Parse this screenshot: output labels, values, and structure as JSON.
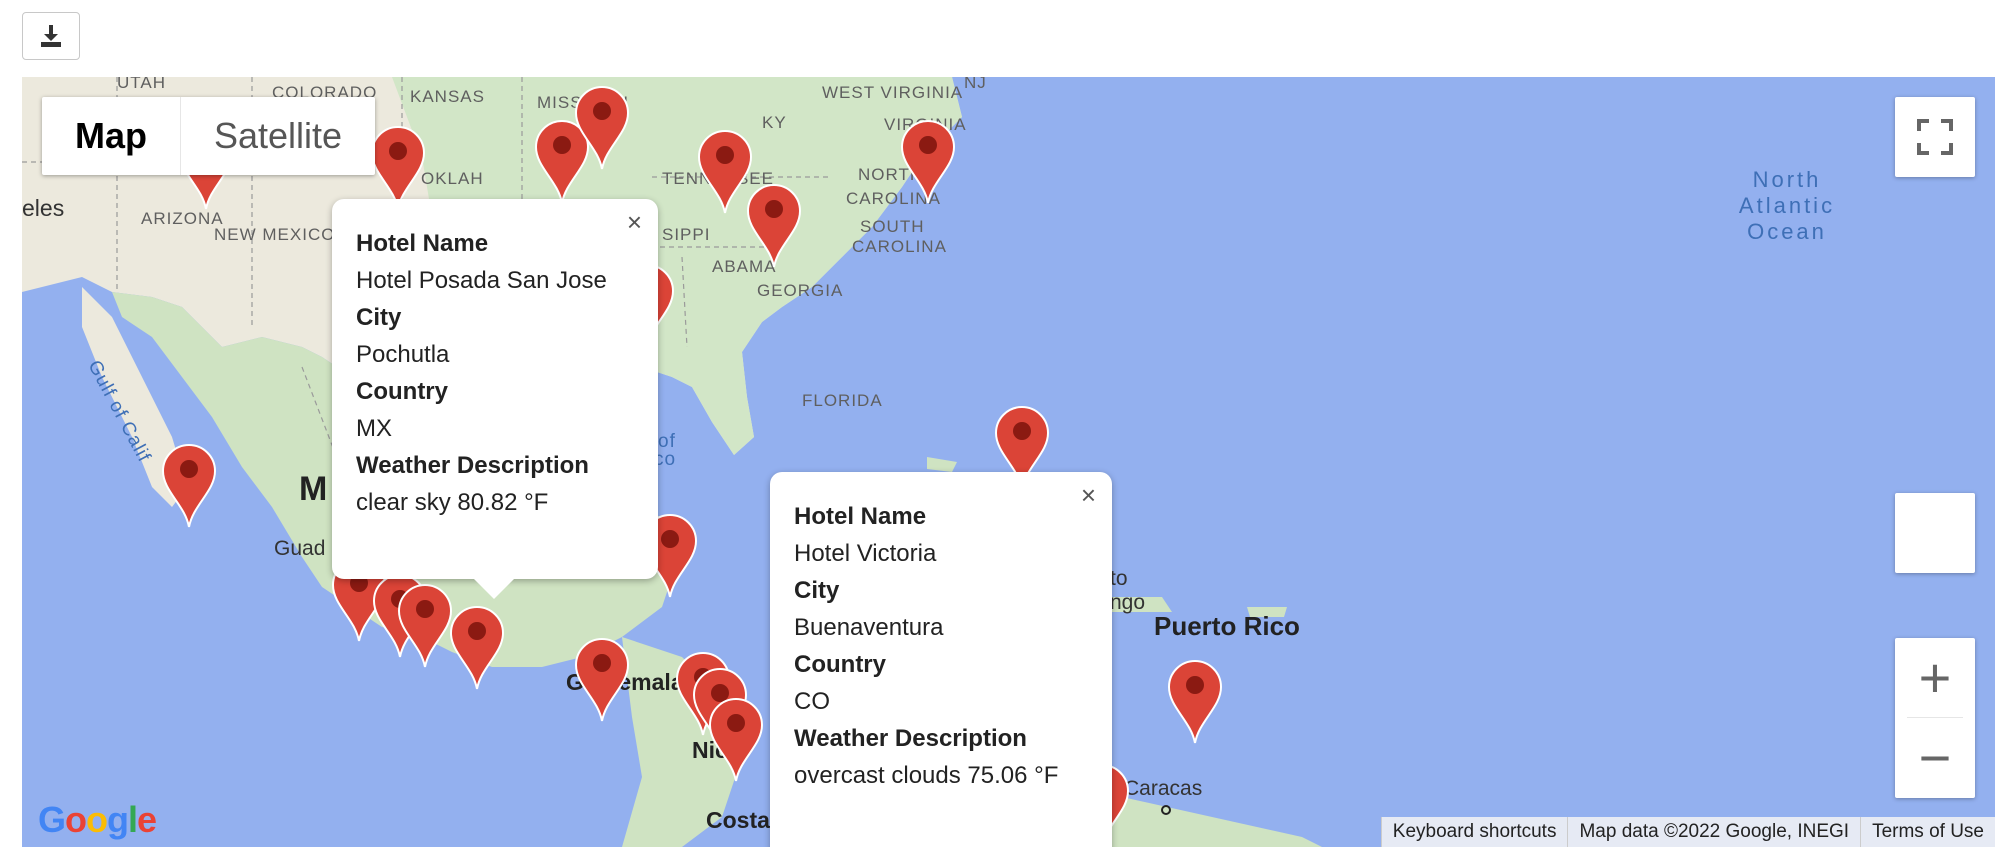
{
  "toolbar": {
    "download_icon": "download-icon"
  },
  "map_type": {
    "map_label": "Map",
    "satellite_label": "Satellite"
  },
  "controls": {
    "fullscreen_icon": "fullscreen-icon",
    "zoom_in": "+",
    "zoom_out": "−"
  },
  "labels": {
    "utah": "UTAH",
    "colorado": "COLORADO",
    "kansas": "KANSAS",
    "missouri": "MISSOURI",
    "west_virginia": "WEST VIRGINIA",
    "virginia": "VIRGINIA",
    "nj": "NJ",
    "kentucky": "KY",
    "tennessee": "TENNESSEE",
    "north_carolina_1": "NORTH",
    "north_carolina_2": "CAROLINA",
    "oklahoma": "OKLAH",
    "arizona": "ARIZONA",
    "new_mexico": "NEW MEXICO",
    "eles": "eles",
    "mississippi": "SIPPI",
    "alabama": "ABAMA",
    "south_carolina_1": "SOUTH",
    "south_carolina_2": "CAROLINA",
    "georgia": "GEORGIA",
    "florida": "FLORIDA",
    "gulf_of_california": "Gulf of Calif",
    "mexico_m": "M",
    "guadalajara": "Guad",
    "gulf_mexico": "of",
    "gulf_mexico2": "co",
    "guatemala": "Guatemala",
    "nicaragua": "Nica",
    "costa_rica": "Costa",
    "caracas": "Caracas",
    "puerto_rico": "Puerto Rico",
    "santo_domingo_1": "to",
    "santo_domingo_2": "ngo",
    "ocean": "North Atlantic Ocean",
    "ocean_1": "North",
    "ocean_2": "Atlantic",
    "ocean_3": "Ocean"
  },
  "info_windows": [
    {
      "hotel_label": "Hotel Name",
      "hotel": "Hotel Posada San Jose",
      "city_label": "City",
      "city": "Pochutla",
      "country_label": "Country",
      "country": "MX",
      "weather_label": "Weather Description",
      "weather": "clear sky 80.82 °F"
    },
    {
      "hotel_label": "Hotel Name",
      "hotel": "Hotel Victoria",
      "city_label": "City",
      "city": "Buenaventura",
      "country_label": "Country",
      "country": "CO",
      "weather_label": "Weather Description",
      "weather": "overcast clouds 75.06 °F"
    }
  ],
  "close_glyph": "×",
  "attribution": {
    "shortcuts": "Keyboard shortcuts",
    "map_data": "Map data ©2022 Google, INEGI",
    "terms": "Terms of Use"
  },
  "logo": {
    "g1": "G",
    "g2": "o",
    "g3": "o",
    "g4": "g",
    "g5": "l",
    "g6": "e"
  },
  "colors": {
    "water": "#93b0ef",
    "land": "#cfe3c2",
    "marker": "#db4437",
    "marker_dot": "#8b1a12"
  }
}
